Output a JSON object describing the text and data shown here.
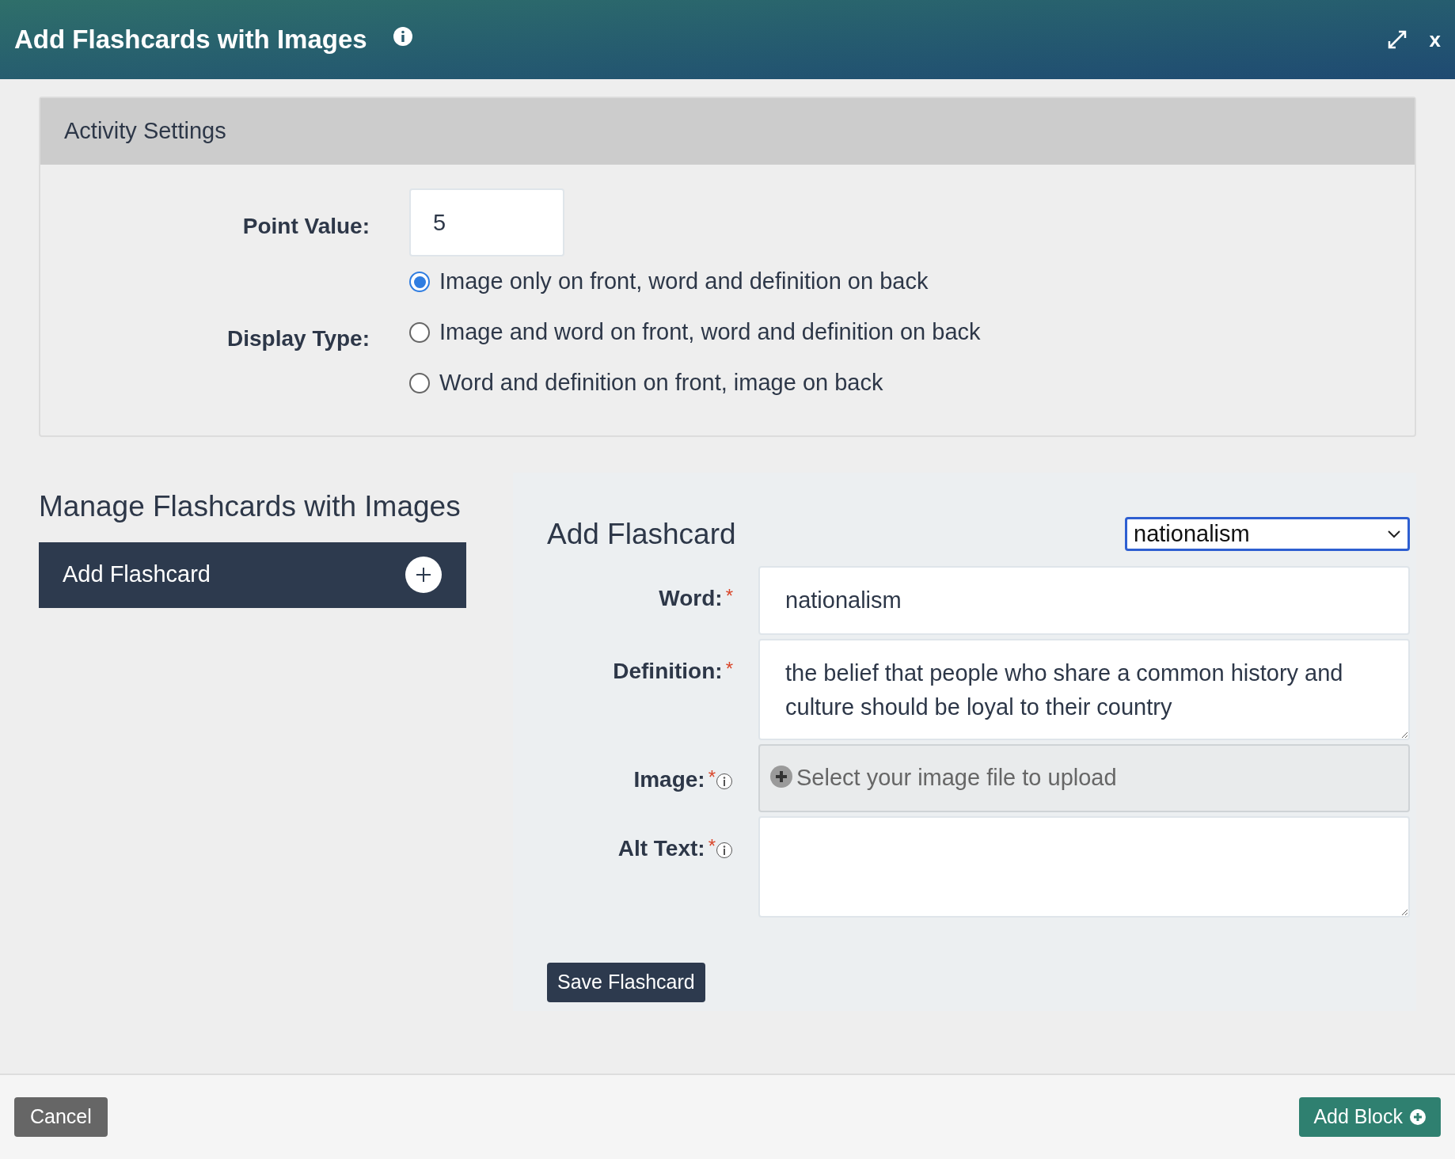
{
  "window": {
    "title": "Add Flashcards with Images",
    "close": "x"
  },
  "activity_settings": {
    "title": "Activity Settings",
    "point_value": {
      "label": "Point Value:",
      "value": "5"
    },
    "display_type": {
      "label": "Display Type:",
      "options": [
        {
          "label": "Image only on front, word and definition on back",
          "selected": true
        },
        {
          "label": "Image and word on front, word and definition on back",
          "selected": false
        },
        {
          "label": "Word and definition on front, image on back",
          "selected": false
        }
      ]
    }
  },
  "manage": {
    "title": "Manage Flashcards with Images",
    "items": [
      {
        "label": "Add Flashcard"
      }
    ]
  },
  "editor": {
    "title": "Add Flashcard",
    "card_select": {
      "value": "nationalism"
    },
    "fields": [
      {
        "kind": "text",
        "label": "Word:",
        "required_mark": "*",
        "info": false,
        "value": "nationalism"
      },
      {
        "kind": "textarea",
        "label": "Definition:",
        "required_mark": "*",
        "info": false,
        "value": "the belief that people who share a common history and culture should be loyal to their country"
      },
      {
        "kind": "file",
        "label": "Image:",
        "required_mark": "*",
        "info": true,
        "placeholder": "Select your image file to upload"
      },
      {
        "kind": "textarea",
        "label": "Alt Text:",
        "required_mark": "*",
        "info": true
      }
    ],
    "save_button": "Save Flashcard"
  },
  "footer": {
    "cancel": "Cancel",
    "add_block": "Add Block"
  }
}
